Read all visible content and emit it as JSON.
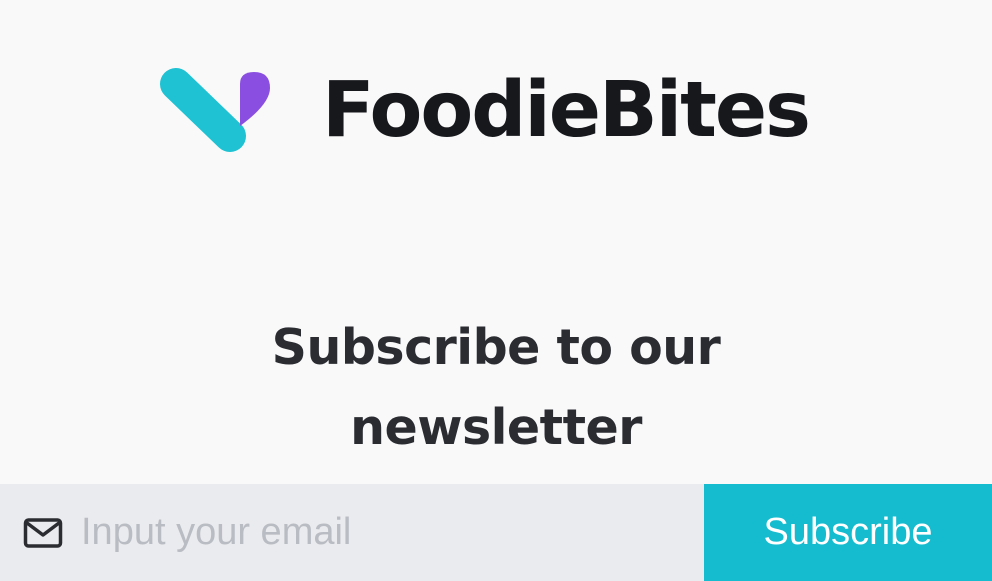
{
  "brand": {
    "name": "FoodieBites",
    "logo_icon": "foodiebites-logo-icon",
    "colors": {
      "teal": "#1ec2d3",
      "purple": "#8a4fe0",
      "text": "#17181c"
    }
  },
  "newsletter": {
    "heading_line1": "Subscribe to our",
    "heading_line2": "newsletter",
    "email_placeholder": "Input your email",
    "email_value": "",
    "mail_icon": "mail-icon",
    "subscribe_label": "Subscribe",
    "button_color": "#15bccf"
  }
}
